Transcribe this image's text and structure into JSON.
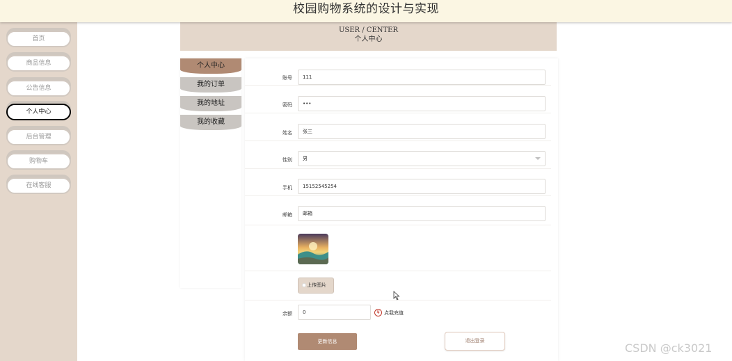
{
  "header": {
    "title": "校园购物系统的设计与实现"
  },
  "sidebar": {
    "items": [
      {
        "label": "首页"
      },
      {
        "label": "商品信息"
      },
      {
        "label": "公告信息"
      },
      {
        "label": "个人中心"
      },
      {
        "label": "后台管理"
      },
      {
        "label": "购物车"
      },
      {
        "label": "在线客服"
      }
    ],
    "active_index": 3
  },
  "banner": {
    "en": "USER / CENTER",
    "cn": "个人中心"
  },
  "menu": {
    "items": [
      {
        "label": "个人中心"
      },
      {
        "label": "我的订单"
      },
      {
        "label": "我的地址"
      },
      {
        "label": "我的收藏"
      }
    ],
    "active_index": 0
  },
  "form": {
    "account": {
      "label": "账号",
      "value": "111"
    },
    "password": {
      "label": "密码",
      "value": "•••"
    },
    "name": {
      "label": "姓名",
      "value": "张三"
    },
    "gender": {
      "label": "性别",
      "value": "男"
    },
    "phone": {
      "label": "手机",
      "value": "15152545254"
    },
    "email": {
      "label": "邮箱",
      "value": "邮箱"
    },
    "upload_label": "上传图片",
    "balance": {
      "label": "余额",
      "value": "0"
    },
    "recharge_icon": "¥",
    "recharge_label": "点我充值",
    "update_label": "更新信息",
    "logout_label": "退出登录"
  },
  "watermark": "CSDN @ck3021",
  "colors": {
    "accent": "#b08a73",
    "sidebar_bg": "#e4d7cb",
    "header_bg": "#fbf6e3"
  }
}
